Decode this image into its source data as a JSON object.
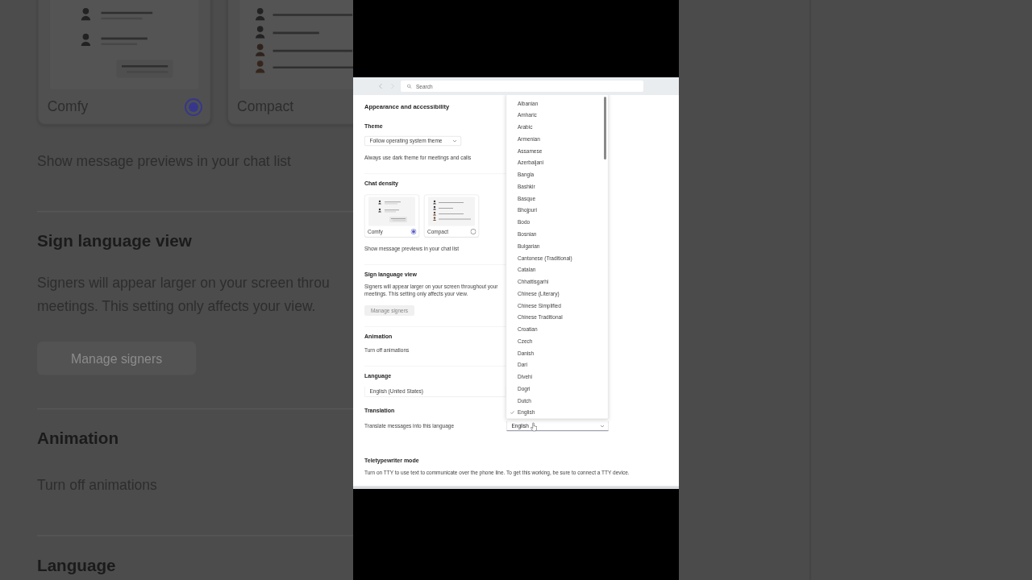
{
  "backdrop": {
    "groups": [
      {
        "sections": [
          {
            "kind": "density",
            "options": [
              {
                "kind": "comfy",
                "label": "Comfy",
                "selected": true
              },
              {
                "kind": "compact",
                "label": "Compact"
              }
            ],
            "description": "Show message previews in your chat list"
          }
        ]
      },
      {
        "sections": [
          {
            "kind": "signers",
            "title": "Sign language view",
            "description_lines": [
              "Signers will appear larger on your screen throu",
              "meetings. This setting only affects your view."
            ],
            "button": {
              "label": "Manage signers",
              "disabled": true
            }
          }
        ]
      },
      {
        "sections": [
          {
            "kind": "toggle",
            "title": "Animation",
            "description": "Turn off animations"
          }
        ]
      },
      {
        "sections": [
          {
            "kind": "heading",
            "title": "Language"
          }
        ]
      }
    ]
  },
  "window": {
    "search": {
      "placeholder": "Search"
    }
  },
  "settings": {
    "title": "Appearance and accessibility",
    "groups": [
      {
        "sections": [
          {
            "kind": "select",
            "title": "Theme",
            "select": {
              "value": "Follow operating system theme"
            },
            "description": "Always use dark theme for meetings and calls"
          }
        ]
      },
      {
        "sections": [
          {
            "kind": "density",
            "title": "Chat density",
            "options": [
              {
                "kind": "comfy",
                "label": "Comfy",
                "selected": true
              },
              {
                "kind": "compact",
                "label": "Compact",
                "selected": false
              }
            ],
            "description": "Show message previews in your chat list"
          }
        ]
      },
      {
        "sections": [
          {
            "kind": "signers",
            "title": "Sign language view",
            "description": "Signers will appear larger on your screen throughout your meetings. This setting only affects your view.",
            "button": {
              "label": "Manage signers",
              "disabled": true
            }
          }
        ]
      },
      {
        "sections": [
          {
            "kind": "toggle",
            "title": "Animation",
            "description": "Turn off animations"
          }
        ]
      },
      {
        "sections": [
          {
            "kind": "wide_select",
            "title": "Language",
            "select": {
              "value": "English (United States)"
            }
          },
          {
            "kind": "row_select",
            "title": "Translation",
            "description": "Translate messages into this language",
            "select": {
              "value": "English",
              "options": [
                {
                  "label": "Albanian",
                  "selected": false
                },
                {
                  "label": "Amharic",
                  "selected": false
                },
                {
                  "label": "Arabic",
                  "selected": false
                },
                {
                  "label": "Armenian",
                  "selected": false
                },
                {
                  "label": "Assamese",
                  "selected": false
                },
                {
                  "label": "Azerbaijani",
                  "selected": false
                },
                {
                  "label": "Bangla",
                  "selected": false
                },
                {
                  "label": "Bashkir",
                  "selected": false
                },
                {
                  "label": "Basque",
                  "selected": false
                },
                {
                  "label": "Bhojpuri",
                  "selected": false
                },
                {
                  "label": "Bodo",
                  "selected": false
                },
                {
                  "label": "Bosnian",
                  "selected": false
                },
                {
                  "label": "Bulgarian",
                  "selected": false
                },
                {
                  "label": "Cantonese (Traditional)",
                  "selected": false
                },
                {
                  "label": "Catalan",
                  "selected": false
                },
                {
                  "label": "Chhattisgarhi",
                  "selected": false
                },
                {
                  "label": "Chinese (Literary)",
                  "selected": false
                },
                {
                  "label": "Chinese Simplified",
                  "selected": false
                },
                {
                  "label": "Chinese Traditional",
                  "selected": false
                },
                {
                  "label": "Croatian",
                  "selected": false
                },
                {
                  "label": "Czech",
                  "selected": false
                },
                {
                  "label": "Danish",
                  "selected": false
                },
                {
                  "label": "Dari",
                  "selected": false
                },
                {
                  "label": "Divehi",
                  "selected": false
                },
                {
                  "label": "Dogri",
                  "selected": false
                },
                {
                  "label": "Dutch",
                  "selected": false
                },
                {
                  "label": "English",
                  "selected": true
                }
              ]
            }
          },
          {
            "kind": "note",
            "title": "Teletypewriter mode",
            "description": "Turn on TTY to use text to communicate over the phone line. To get this working, be sure to connect a TTY device."
          }
        ]
      }
    ]
  }
}
